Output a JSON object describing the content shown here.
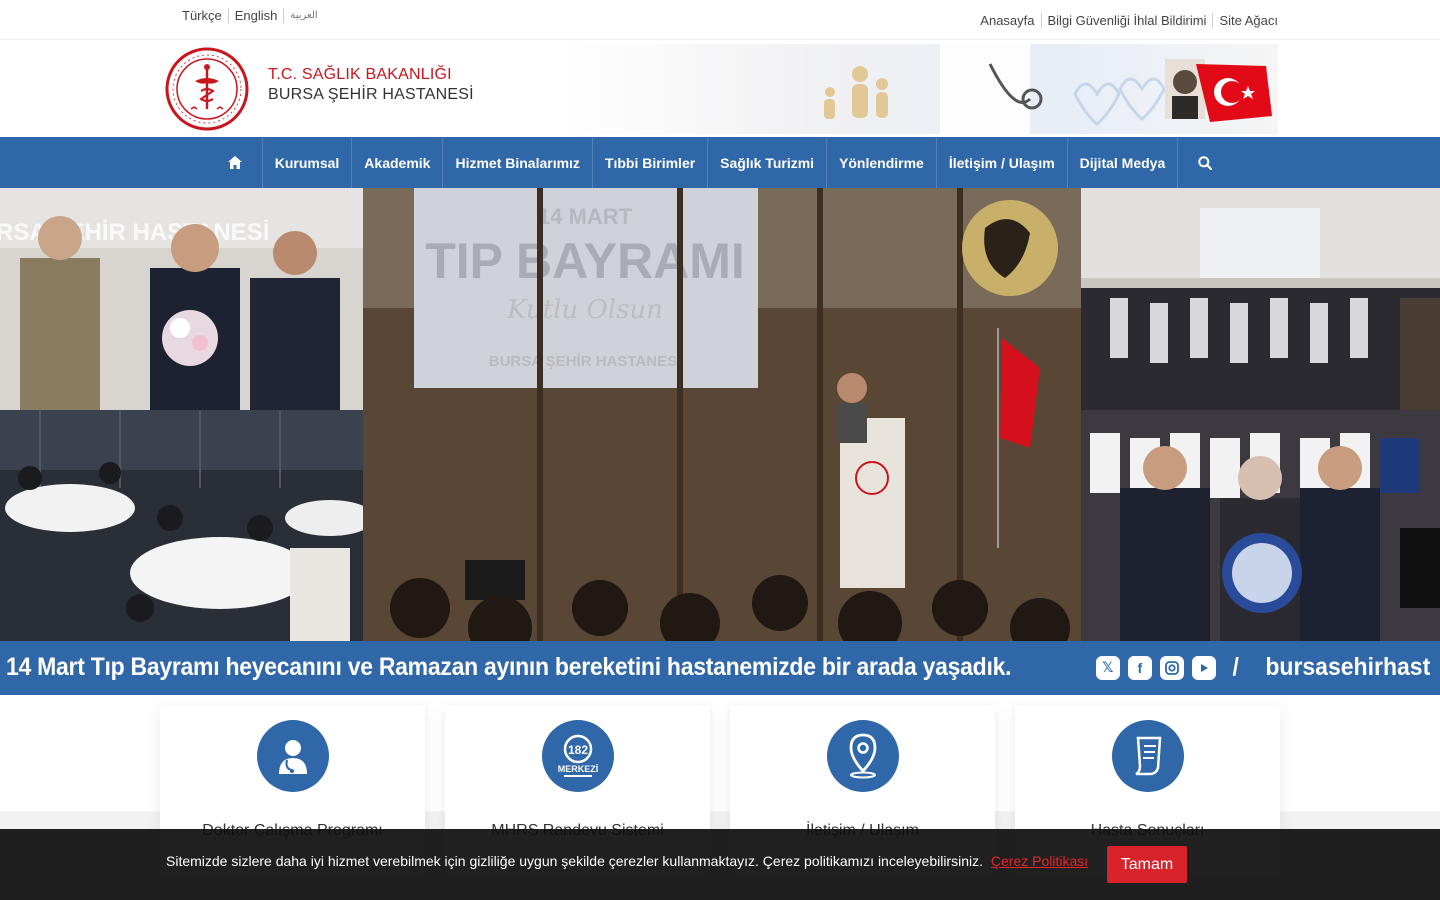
{
  "top": {
    "languages": [
      "Türkçe",
      "English",
      "العربية"
    ],
    "links": [
      "Anasayfa",
      "Bilgi Güvenliği İhlal Bildirimi",
      "Site Ağacı"
    ]
  },
  "brand": {
    "line1": "T.C. SAĞLIK BAKANLIĞI",
    "line2": "BURSA ŞEHİR HASTANESİ"
  },
  "nav": {
    "items": [
      "Kurumsal",
      "Akademik",
      "Hizmet Binalarımız",
      "Tıbbi Birimler",
      "Sağlık Turizmi",
      "Yönlendirme",
      "İletişim / Ulaşım",
      "Dijital Medya"
    ]
  },
  "slider": {
    "screen_line1": "14 MART",
    "screen_line2": "TIP BAYRAMI",
    "screen_line3": "Kutlu Olsun",
    "screen_line4": "BURSA ŞEHİR HASTANESİ",
    "caption": "14 Mart Tıp Bayramı heyecanını ve Ramazan ayının bereketini hastanemizde bir arada yaşadık.",
    "handle_sep": "/",
    "handle": "bursasehirhast"
  },
  "cards": [
    {
      "title": "Doktor Çalışma Programı",
      "icon": "doctor-icon"
    },
    {
      "title": "MHRS Randevu Sistemi",
      "icon": "phone-182-icon"
    },
    {
      "title": "İletişim / Ulaşım",
      "icon": "location-pin-icon"
    },
    {
      "title": "Hasta Sonuçları",
      "icon": "document-icon"
    }
  ],
  "cookie": {
    "text": "Sitemizde sizlere daha iyi hizmet verebilmek için gizliliğe uygun şekilde çerezler kullanmaktayız. Çerez politikamızı inceleyebilirsiniz.",
    "link": "Çerez Politikası",
    "button": "Tamam"
  },
  "colors": {
    "primary": "#2f67a8",
    "accent_red": "#c8161d",
    "cookie_btn": "#d9232b"
  }
}
